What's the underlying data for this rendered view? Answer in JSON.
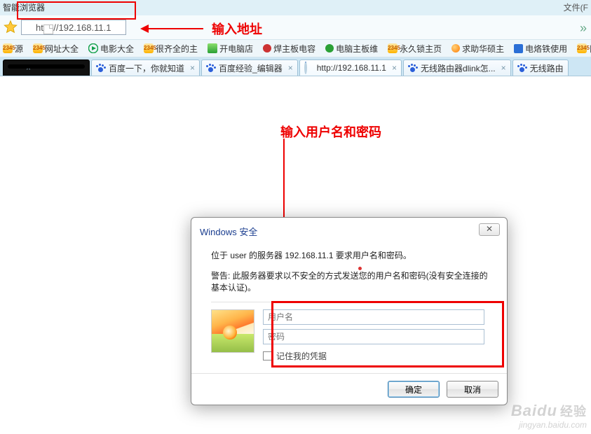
{
  "chrome": {
    "title": "智能浏览器",
    "menu_right": "文件(F"
  },
  "address": {
    "value": "http://192.168.11.1"
  },
  "annotations": {
    "addr_note": "输入地址",
    "cred_note": "输入用户名和密码"
  },
  "bookmarks": [
    {
      "label": "源",
      "icon": "g2345"
    },
    {
      "label": "网址大全",
      "icon": "g2345"
    },
    {
      "label": "电影大全",
      "icon": "play"
    },
    {
      "label": "很齐全的主",
      "icon": "g2345"
    },
    {
      "label": "开电脑店",
      "icon": "green-stack"
    },
    {
      "label": "焊主板电容",
      "icon": "red-dot"
    },
    {
      "label": "电脑主板维",
      "icon": "green-dot"
    },
    {
      "label": "永久锁主页",
      "icon": "g2345"
    },
    {
      "label": "求助华硕主",
      "icon": "orange-dot"
    },
    {
      "label": "电烙铁使用",
      "icon": "blue-sq"
    },
    {
      "label": "日积",
      "icon": "g2345"
    }
  ],
  "tabs": [
    {
      "title": "",
      "style": "dark",
      "icon": "none",
      "closable": true
    },
    {
      "title": "百度一下，你就知道",
      "icon": "paw",
      "closable": true
    },
    {
      "title": "百度经验_编辑器",
      "icon": "paw",
      "closable": true
    },
    {
      "title": "http://192.168.11.1",
      "icon": "spinner",
      "closable": true,
      "active": true
    },
    {
      "title": "无线路由器dlink怎...",
      "icon": "paw",
      "closable": true
    },
    {
      "title": "无线路由",
      "icon": "paw",
      "closable": false
    }
  ],
  "dialog": {
    "title": "Windows 安全",
    "line1": "位于 user 的服务器 192.168.11.1 要求用户名和密码。",
    "warning": "警告: 此服务器要求以不安全的方式发送您的用户名和密码(没有安全连接的基本认证)。",
    "username_placeholder": "用户名",
    "password_placeholder": "密码",
    "remember_label": "记住我的凭据",
    "ok": "确定",
    "cancel": "取消",
    "close_glyph": "✕"
  },
  "watermark": {
    "brand": "Baidu",
    "brand_cn": "经验",
    "url": "jingyan.baidu.com"
  }
}
